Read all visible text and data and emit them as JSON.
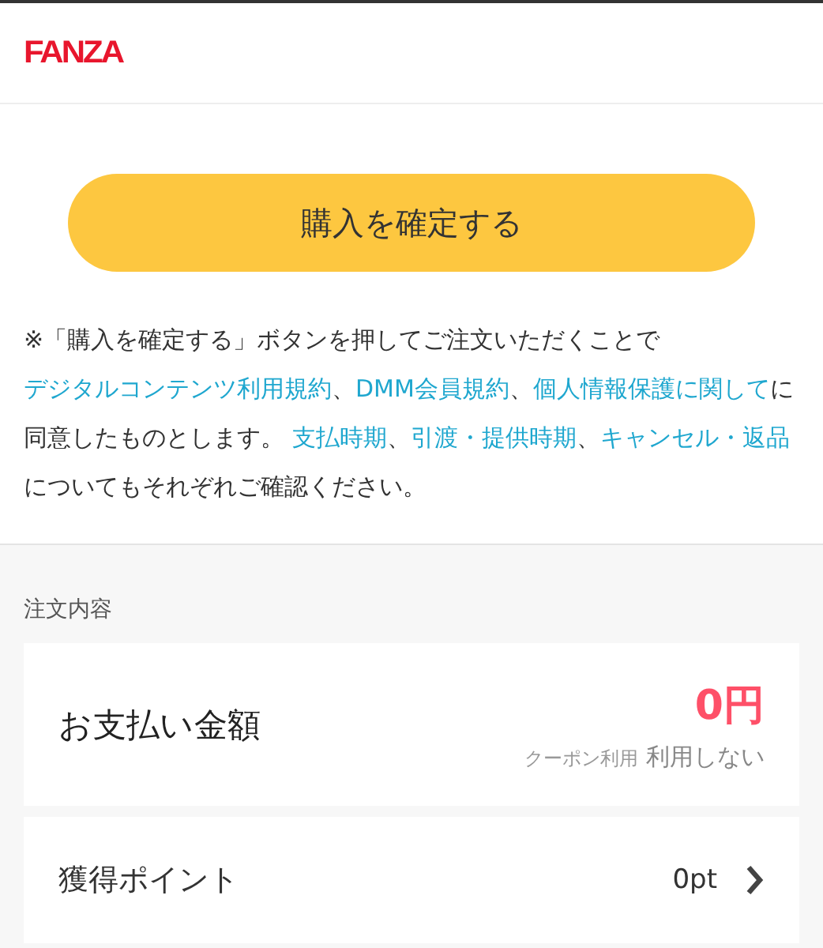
{
  "header": {
    "logo": "FANZA"
  },
  "confirm_button": "購入を確定する",
  "notice": [
    {
      "text": "※「購入を確定する」ボタンを押してご注文いただくことで ",
      "link": false
    },
    {
      "text": "デジタルコンテンツ利用規約",
      "link": true
    },
    {
      "text": "、",
      "link": false
    },
    {
      "text": "DMM会員規約",
      "link": true
    },
    {
      "text": "、",
      "link": false
    },
    {
      "text": "個人情報保護に関して",
      "link": true
    },
    {
      "text": "に同意したものとします。 ",
      "link": false
    },
    {
      "text": "支払時期",
      "link": true
    },
    {
      "text": "、",
      "link": false
    },
    {
      "text": "引渡・提供時期",
      "link": true
    },
    {
      "text": "、",
      "link": false
    },
    {
      "text": "キャンセル・返品",
      "link": true
    },
    {
      "text": "についてもそれぞれご確認ください。",
      "link": false
    }
  ],
  "order": {
    "heading": "注文内容",
    "payment": {
      "label": "お支払い金額",
      "amount": "0円",
      "coupon_label": "クーポン利用",
      "coupon_value": "利用しない"
    },
    "points": {
      "label": "獲得ポイント",
      "value": "0pt"
    }
  }
}
